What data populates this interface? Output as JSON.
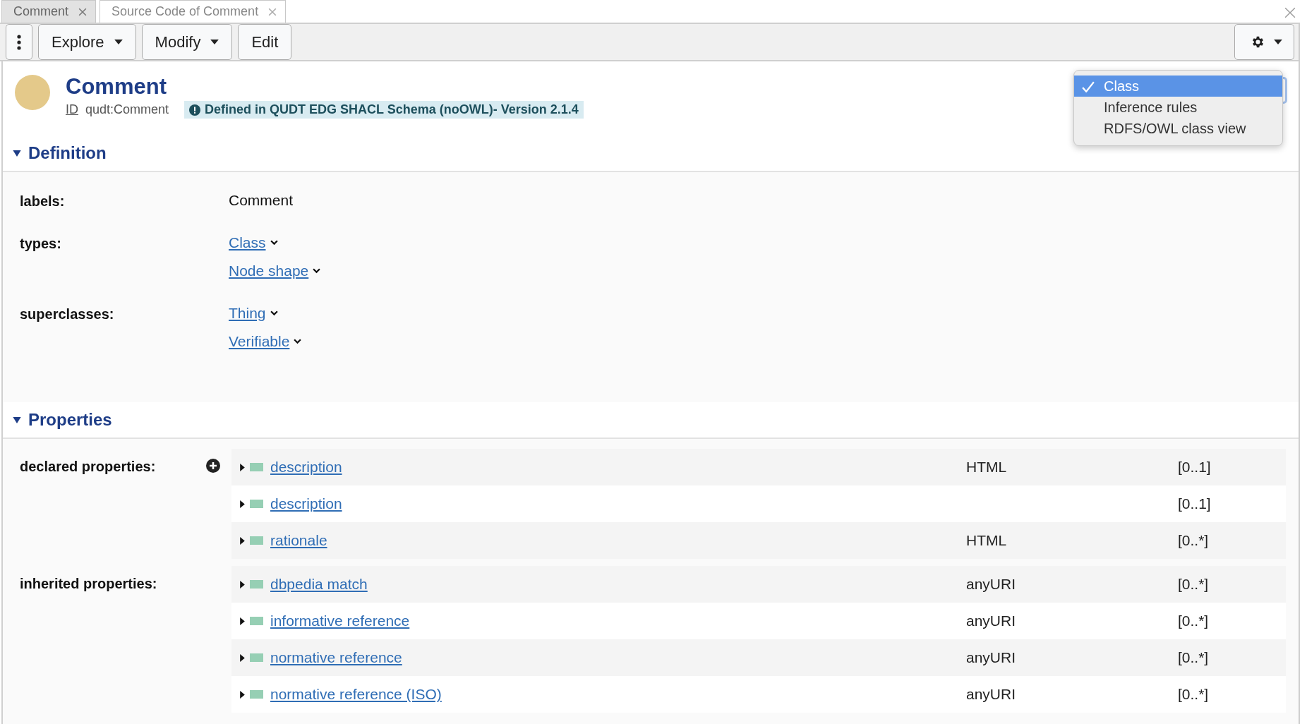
{
  "tabs": [
    {
      "label": "Comment",
      "selected": true,
      "closable": true
    },
    {
      "label": "Source Code of Comment",
      "selected": false,
      "closable": true
    }
  ],
  "toolbar": {
    "buttons": [
      {
        "kind": "kebab"
      },
      {
        "kind": "dropdown",
        "label": "Explore"
      },
      {
        "kind": "dropdown",
        "label": "Modify"
      },
      {
        "kind": "plain",
        "label": "Edit"
      }
    ],
    "settings": {
      "kind": "gear"
    }
  },
  "resource": {
    "name": "Comment",
    "id_label": "ID",
    "id": "qudt:Comment",
    "notice": "Defined in QUDT EDG SHACL Schema (noOWL)- Version 2.1.4"
  },
  "view_menu": {
    "open": true,
    "items": [
      {
        "label": "Class",
        "selected": true
      },
      {
        "label": "Inference rules",
        "selected": false
      },
      {
        "label": "RDFS/OWL class view",
        "selected": false
      }
    ]
  },
  "sections": [
    {
      "kind": "definition",
      "title": "Definition",
      "expanded": true,
      "fields": [
        {
          "label": "labels:",
          "values": [
            {
              "kind": "text",
              "text": "Comment"
            }
          ]
        },
        {
          "label": "types:",
          "values": [
            {
              "kind": "link",
              "text": "Class"
            },
            {
              "kind": "link",
              "text": "Node shape"
            }
          ]
        },
        {
          "label": "superclasses:",
          "values": [
            {
              "kind": "link",
              "text": "Thing"
            },
            {
              "kind": "link",
              "text": "Verifiable"
            }
          ]
        }
      ]
    },
    {
      "kind": "properties",
      "title": "Properties",
      "expanded": true,
      "groups": [
        {
          "label": "declared properties:",
          "add_button": true,
          "rows": [
            {
              "name": "description",
              "type": "HTML",
              "cardinality": "[0..1]"
            },
            {
              "name": "description",
              "type": "",
              "cardinality": "[0..1]"
            },
            {
              "name": "rationale",
              "type": "HTML",
              "cardinality": "[0..*]"
            }
          ]
        },
        {
          "label": "inherited properties:",
          "add_button": false,
          "rows": [
            {
              "name": "dbpedia match",
              "type": "anyURI",
              "cardinality": "[0..*]"
            },
            {
              "name": "informative reference",
              "type": "anyURI",
              "cardinality": "[0..*]"
            },
            {
              "name": "normative reference",
              "type": "anyURI",
              "cardinality": "[0..*]"
            },
            {
              "name": "normative reference (ISO)",
              "type": "anyURI",
              "cardinality": "[0..*]"
            }
          ]
        }
      ]
    }
  ]
}
